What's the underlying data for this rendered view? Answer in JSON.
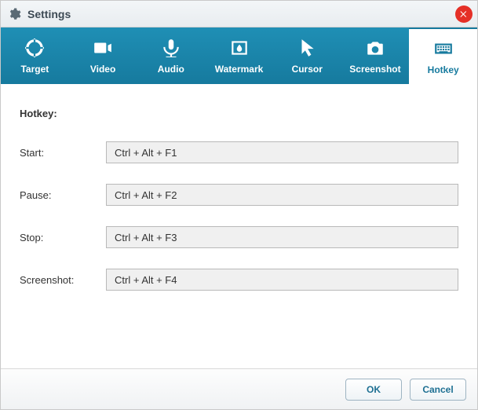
{
  "window": {
    "title": "Settings"
  },
  "tabs": {
    "target": "Target",
    "video": "Video",
    "audio": "Audio",
    "watermark": "Watermark",
    "cursor": "Cursor",
    "screenshot": "Screenshot",
    "hotkey": "Hotkey"
  },
  "section": {
    "title": "Hotkey:"
  },
  "fields": {
    "start": {
      "label": "Start:",
      "value": "Ctrl + Alt + F1"
    },
    "pause": {
      "label": "Pause:",
      "value": "Ctrl + Alt + F2"
    },
    "stop": {
      "label": "Stop:",
      "value": "Ctrl + Alt + F3"
    },
    "screenshot": {
      "label": "Screenshot:",
      "value": "Ctrl + Alt + F4"
    }
  },
  "footer": {
    "ok": "OK",
    "cancel": "Cancel"
  }
}
